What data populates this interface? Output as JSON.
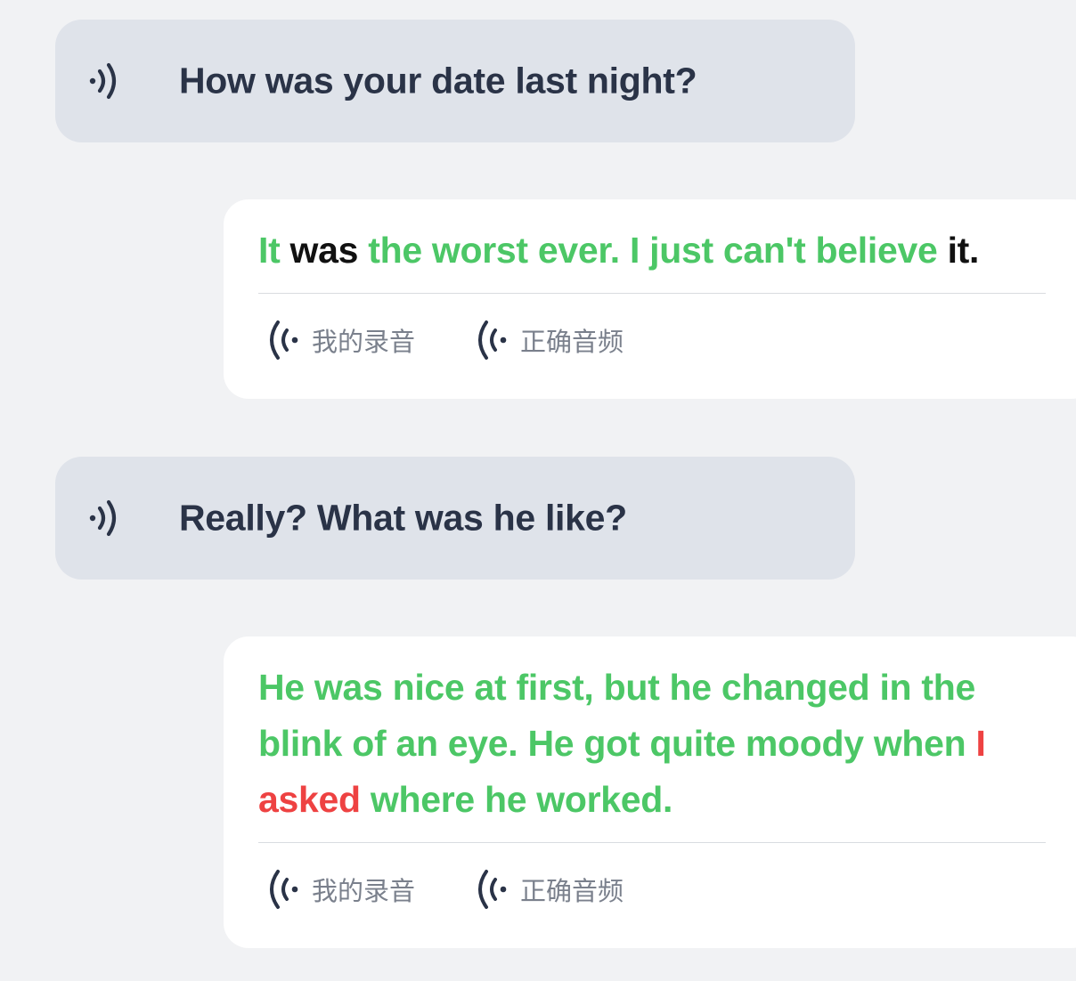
{
  "conversation": [
    {
      "role": "prompt",
      "text": "How was your date last night?",
      "icon": "speaker-icon"
    },
    {
      "role": "answer",
      "words": [
        {
          "text": "It",
          "status": "good"
        },
        {
          "text": " was",
          "status": "mid"
        },
        {
          "text": " the worst ever. I just can't believe",
          "status": "good"
        },
        {
          "text": " it.",
          "status": "mid"
        }
      ],
      "my_recording_label": "我的录音",
      "correct_audio_label": "正确音频"
    },
    {
      "role": "prompt",
      "text": "Really? What was he like?",
      "icon": "speaker-icon"
    },
    {
      "role": "answer",
      "words": [
        {
          "text": "He was nice at first, but he changed in the blink of an eye. He got quite moody when",
          "status": "good"
        },
        {
          "text": " I asked",
          "status": "bad"
        },
        {
          "text": " where he worked.",
          "status": "good"
        }
      ],
      "my_recording_label": "我的录音",
      "correct_audio_label": "正确音频"
    }
  ],
  "colors": {
    "good": "#4cc766",
    "mid": "#111111",
    "bad": "#ee4242",
    "prompt_bg": "#dfe3ea",
    "page_bg": "#f1f2f4"
  }
}
